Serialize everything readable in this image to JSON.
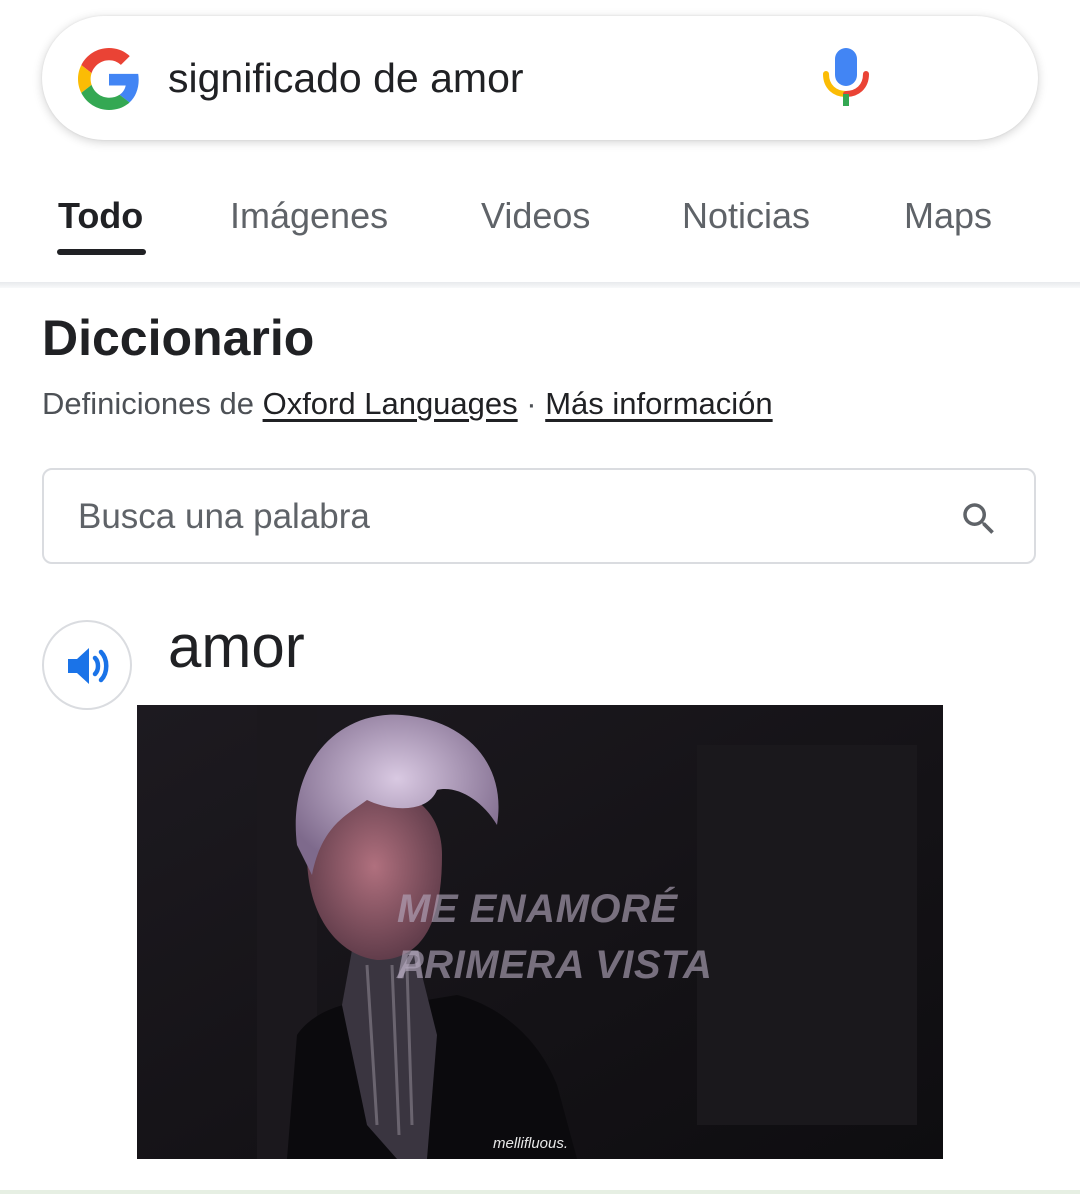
{
  "search": {
    "query": "significado de amor"
  },
  "tabs": [
    {
      "label": "Todo",
      "active": true
    },
    {
      "label": "Imágenes",
      "active": false
    },
    {
      "label": "Videos",
      "active": false
    },
    {
      "label": "Noticias",
      "active": false
    },
    {
      "label": "Maps",
      "active": false
    }
  ],
  "dictionary": {
    "title": "Diccionario",
    "source_prefix": "Definiciones de ",
    "source_link": "Oxford Languages",
    "separator": " · ",
    "more_info": "Más información",
    "word_search_placeholder": "Busca una palabra",
    "word": "amor"
  },
  "image": {
    "caption_line1": "ME ENAMORÉ A",
    "caption_line2": "PRIMERA VISTA",
    "watermark": "mellifluous."
  },
  "icons": {
    "logo": "google-g-icon",
    "voice": "microphone-icon",
    "search": "search-icon",
    "audio": "speaker-icon"
  },
  "colors": {
    "google_blue": "#4285F4",
    "google_red": "#EA4335",
    "google_yellow": "#FBBC05",
    "google_green": "#34A853",
    "speaker_blue": "#1a73e8"
  }
}
